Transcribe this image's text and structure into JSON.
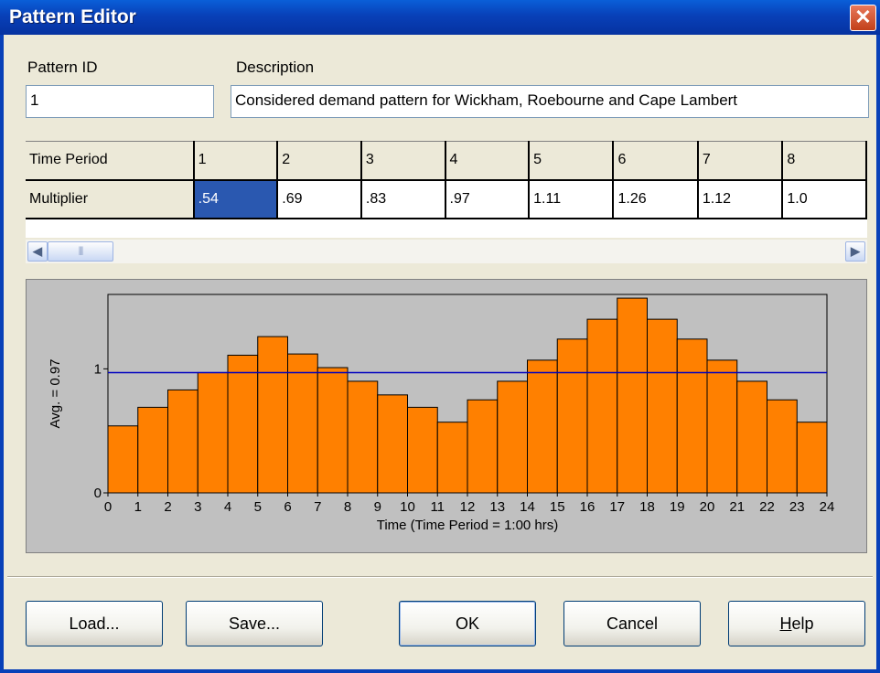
{
  "window": {
    "title": "Pattern Editor",
    "close_glyph": "✕"
  },
  "fields": {
    "pattern_id_label": "Pattern ID",
    "pattern_id_value": "1",
    "description_label": "Description",
    "description_value": "Considered demand pattern for Wickham, Roebourne and Cape Lambert"
  },
  "grid": {
    "row1_header": "Time Period",
    "row2_header": "Multiplier",
    "periods": [
      "1",
      "2",
      "3",
      "4",
      "5",
      "6",
      "7",
      "8"
    ],
    "multipliers": [
      ".54",
      ".69",
      ".83",
      ".97",
      "1.11",
      "1.26",
      "1.12",
      "1.0"
    ],
    "selected_index": 0
  },
  "scrollbar": {
    "left_icon": "scroll-left-arrow-icon",
    "right_icon": "scroll-right-arrow-icon",
    "thumb_grip": "|||"
  },
  "chart_data": {
    "type": "bar",
    "title": "",
    "xlabel": "Time (Time Period = 1:00 hrs)",
    "ylabel": "Avg. = 0.97",
    "x_ticks": [
      "0",
      "1",
      "2",
      "3",
      "4",
      "5",
      "6",
      "7",
      "8",
      "9",
      "10",
      "11",
      "12",
      "13",
      "14",
      "15",
      "16",
      "17",
      "18",
      "19",
      "20",
      "21",
      "22",
      "23",
      "24"
    ],
    "y_ticks": [
      "0",
      "1"
    ],
    "ylim": [
      0,
      1.6
    ],
    "xlim": [
      0,
      24
    ],
    "values": [
      0.54,
      0.69,
      0.83,
      0.97,
      1.11,
      1.26,
      1.12,
      1.01,
      0.9,
      0.79,
      0.69,
      0.57,
      0.75,
      0.9,
      1.07,
      1.24,
      1.4,
      1.57,
      1.4,
      1.24,
      1.07,
      0.9,
      0.75,
      0.57
    ],
    "average": 0.97,
    "bar_color": "#ff8000",
    "average_line_color": "#0000c0",
    "plot_background": "#c0c0c0",
    "grid": false
  },
  "buttons": {
    "load": "Load...",
    "save": "Save...",
    "ok": "OK",
    "cancel": "Cancel",
    "help_prefix": "H",
    "help_rest": "elp"
  }
}
